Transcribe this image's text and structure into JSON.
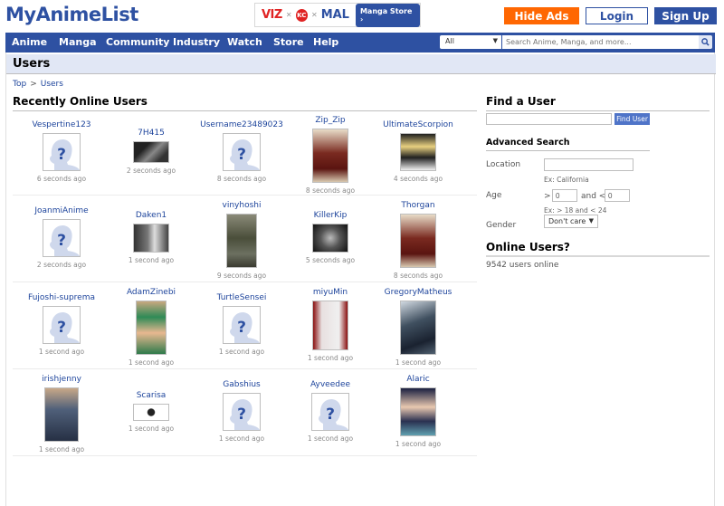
{
  "header": {
    "logo": "MyAnimeList",
    "banner": {
      "viz": "VIZ",
      "kc": "KC",
      "mal": "MAL",
      "store_label": "Manga Store ›"
    },
    "hide_ads": "Hide Ads",
    "login": "Login",
    "signup": "Sign Up"
  },
  "nav": {
    "items": [
      "Anime",
      "Manga",
      "Community",
      "Industry",
      "Watch",
      "Store",
      "Help"
    ],
    "search_category": "All",
    "search_placeholder": "Search Anime, Manga, and more..."
  },
  "page": {
    "title": "Users",
    "breadcrumb": [
      "Top",
      "Users"
    ],
    "recent_heading": "Recently Online Users"
  },
  "users": [
    [
      {
        "name": "Vespertine123",
        "ago": "6 seconds ago",
        "avatar": "placeholder"
      },
      {
        "name": "7H415",
        "ago": "2 seconds ago",
        "avatar": "wide-dark"
      },
      {
        "name": "Username23489023",
        "ago": "8 seconds ago",
        "avatar": "placeholder"
      },
      {
        "name": "Zip_Zip",
        "ago": "8 seconds ago",
        "avatar": "tall-red"
      },
      {
        "name": "UltimateScorpion",
        "ago": "4 seconds ago",
        "avatar": "square-anime"
      }
    ],
    [
      {
        "name": "JoanmiAnime",
        "ago": "2 seconds ago",
        "avatar": "placeholder"
      },
      {
        "name": "Daken1",
        "ago": "1 second ago",
        "avatar": "wide-grey"
      },
      {
        "name": "vinyhoshi",
        "ago": "9 seconds ago",
        "avatar": "tall-soldier"
      },
      {
        "name": "KillerKip",
        "ago": "5 seconds ago",
        "avatar": "wide-bw"
      },
      {
        "name": "Thorgan",
        "ago": "8 seconds ago",
        "avatar": "tall-red"
      }
    ],
    [
      {
        "name": "Fujoshi-suprema",
        "ago": "1 second ago",
        "avatar": "placeholder"
      },
      {
        "name": "AdamZinebi",
        "ago": "1 second ago",
        "avatar": "tall-green"
      },
      {
        "name": "TurtleSensei",
        "ago": "1 second ago",
        "avatar": "placeholder"
      },
      {
        "name": "miyuMin",
        "ago": "1 second ago",
        "avatar": "tall-white"
      },
      {
        "name": "GregoryMatheus",
        "ago": "1 second ago",
        "avatar": "tall-dark"
      }
    ],
    [
      {
        "name": "irishjenny",
        "ago": "1 second ago",
        "avatar": "tall-blue"
      },
      {
        "name": "Scarisa",
        "ago": "1 second ago",
        "avatar": "wide-small"
      },
      {
        "name": "Gabshius",
        "ago": "1 second ago",
        "avatar": "placeholder"
      },
      {
        "name": "Ayveedee",
        "ago": "1 second ago",
        "avatar": "placeholder"
      },
      {
        "name": "Alaric",
        "ago": "1 second ago",
        "avatar": "square-anime2"
      }
    ]
  ],
  "find_user": {
    "heading": "Find a User",
    "input_value": "",
    "button": "Find User",
    "advanced_heading": "Advanced Search",
    "location_label": "Location",
    "location_value": "",
    "location_hint": "Ex: California",
    "age_label": "Age",
    "age_gt": ">",
    "age_min": "0",
    "age_and": "and <",
    "age_max": "0",
    "age_hint": "Ex: > 18 and < 24",
    "gender_label": "Gender",
    "gender_value": "Don't care"
  },
  "online": {
    "heading": "Online Users?",
    "count_text": "9542 users online"
  },
  "colors": {
    "brand": "#2e51a2",
    "hide_ads": "#ff6702",
    "title_bar": "#e1e7f5"
  }
}
